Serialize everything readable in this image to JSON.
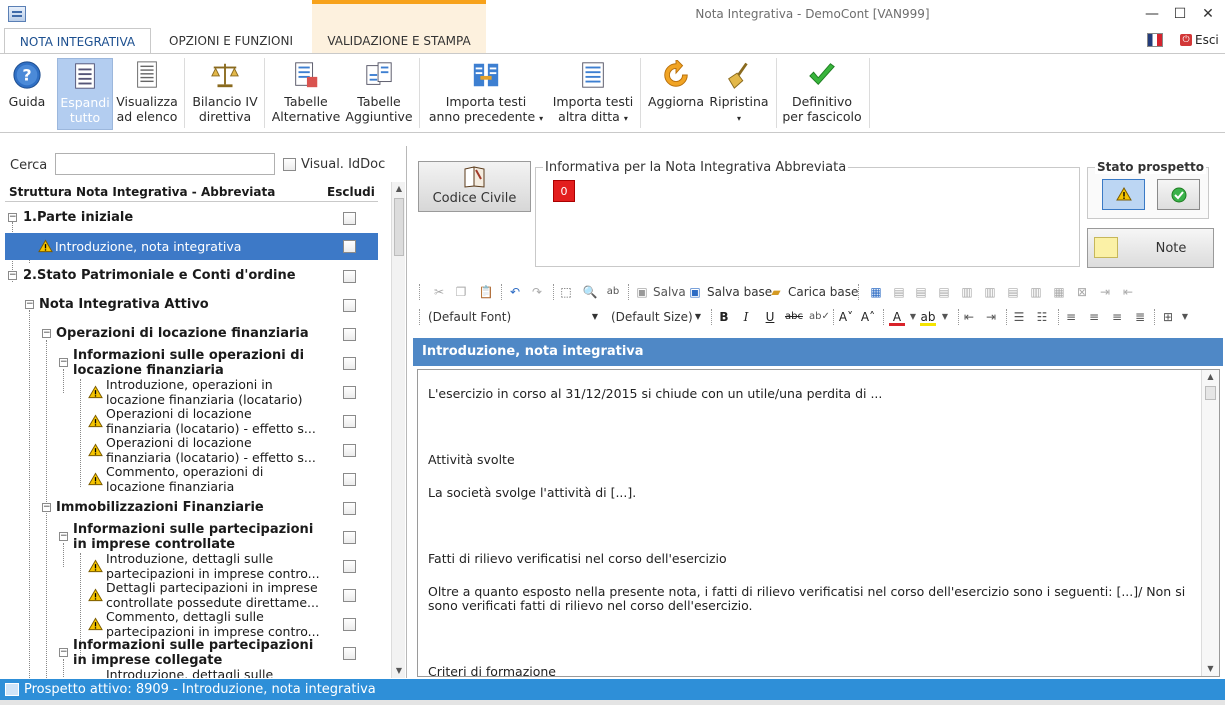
{
  "window": {
    "title": "Nota Integrativa - DemoCont [VAN999]",
    "minimize": "—",
    "maximize": "☐",
    "close": "✕"
  },
  "tabs": [
    {
      "label": "NOTA INTEGRATIVA",
      "active": true
    },
    {
      "label": "OPZIONI E FUNZIONI",
      "active": false
    },
    {
      "label": "VALIDAZIONE E STAMPA",
      "active": false
    }
  ],
  "esci_label": "Esci",
  "ribbon": {
    "guida": "Guida",
    "espandi_1": "Espandi",
    "espandi_2": "tutto",
    "visualizza_1": "Visualizza",
    "visualizza_2": "ad elenco",
    "bilancio_1": "Bilancio IV",
    "bilancio_2": "direttiva",
    "tabalt_1": "Tabelle",
    "tabalt_2": "Alternative",
    "tabagg_1": "Tabelle",
    "tabagg_2": "Aggiuntive",
    "importa_prec_1": "Importa testi",
    "importa_prec_2": "anno precedente",
    "importa_altra_1": "Importa testi",
    "importa_altra_2": "altra ditta",
    "aggiorna": "Aggiorna",
    "ripristina": "Ripristina",
    "definitivo_1": "Definitivo",
    "definitivo_2": "per fascicolo"
  },
  "left": {
    "cerca_label": "Cerca",
    "cerca_value": "",
    "visual_label": "Visual. IdDoc",
    "col_struttura": "Struttura Nota Integrativa - Abbreviata",
    "col_escludi": "Escludi"
  },
  "tree": [
    {
      "l1": "1.Parte iniziale",
      "l2": ""
    },
    {
      "l1": "Introduzione, nota integrativa",
      "l2": ""
    },
    {
      "l1": "2.Stato Patrimoniale e Conti d'ordine",
      "l2": ""
    },
    {
      "l1": "Nota Integrativa Attivo",
      "l2": ""
    },
    {
      "l1": "Operazioni di locazione finanziaria",
      "l2": ""
    },
    {
      "l1": "Informazioni sulle operazioni di",
      "l2": "locazione finanziaria"
    },
    {
      "l1": "Introduzione, operazioni in",
      "l2": "locazione finanziaria (locatario)"
    },
    {
      "l1": "Operazioni di locazione",
      "l2": "finanziaria (locatario) - effetto s..."
    },
    {
      "l1": "Operazioni di locazione",
      "l2": "finanziaria (locatario) - effetto s..."
    },
    {
      "l1": "Commento, operazioni di",
      "l2": "locazione finanziaria"
    },
    {
      "l1": "Immobilizzazioni Finanziarie",
      "l2": ""
    },
    {
      "l1": "Informazioni sulle partecipazioni",
      "l2": "in imprese controllate"
    },
    {
      "l1": "Introduzione, dettagli sulle",
      "l2": "partecipazioni in imprese contro..."
    },
    {
      "l1": "Dettagli partecipazioni in imprese",
      "l2": "controllate possedute direttame..."
    },
    {
      "l1": "Commento, dettagli sulle",
      "l2": "partecipazioni in imprese contro..."
    },
    {
      "l1": "Informazioni sulle partecipazioni",
      "l2": "in imprese collegate"
    },
    {
      "l1": "Introduzione, dettagli sulle",
      "l2": ""
    }
  ],
  "right": {
    "codice_civile": "Codice Civile",
    "info_title": "Informativa per la Nota Integrativa Abbreviata",
    "info_badge": "0",
    "stato_title": "Stato prospetto",
    "note_label": "Note"
  },
  "toolbar": {
    "salva": "Salva",
    "salva_base": "Salva base",
    "carica_base": "Carica base",
    "font": "(Default Font)",
    "size": "(Default Size)"
  },
  "doc": {
    "header": "Introduzione, nota integrativa",
    "p1": "L'esercizio in corso al 31/12/2015 si chiude con un utile/una perdita di ...",
    "p2": "Attività svolte",
    "p3": "La società svolge l'attività di [...].",
    "p4": "Fatti di rilievo verificatisi nel corso dell'esercizio",
    "p5a": "Oltre a quanto esposto nella presente nota, i fatti di rilievo verificatisi nel corso dell'esercizio sono i seguenti: [...]/ Non si",
    "p5b": "sono verificati fatti di rilievo nel corso dell'esercizio.",
    "p6": "Criteri di formazione"
  },
  "status": "Prospetto attivo: 8909 - Introduzione, nota integrativa",
  "colors": {
    "selection": "#3d79c7",
    "header_blue": "#4f88c6",
    "statusbar": "#2e8fd8",
    "orange_tab": "#f7a21b"
  }
}
